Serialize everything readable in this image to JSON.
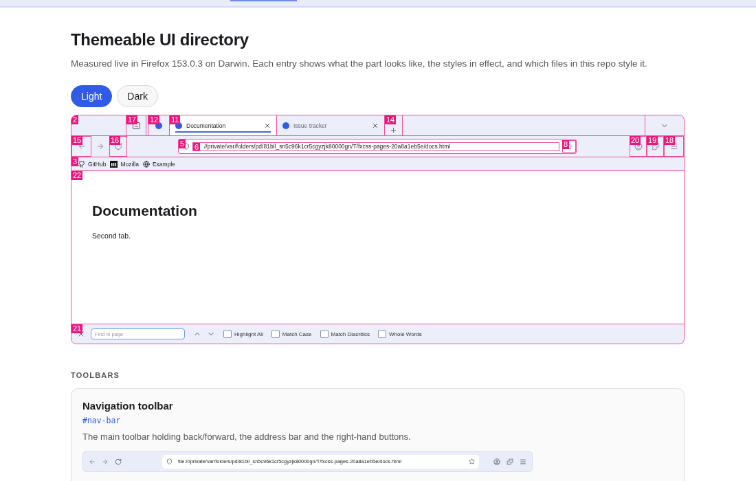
{
  "page": {
    "title": "Themeable UI directory",
    "subtitle": "Measured live in Firefox 153.0.3 on Darwin. Each entry shows what the part looks like, the styles in effect, and which files in this repo style it.",
    "themes": [
      {
        "label": "Light",
        "selected": true
      },
      {
        "label": "Dark",
        "selected": false
      }
    ]
  },
  "browser": {
    "tab_strip": {
      "badge": "2",
      "items": [
        {
          "kind": "button",
          "badge": "17"
        },
        {
          "kind": "pinned-tab",
          "badge": "12"
        },
        {
          "kind": "tab",
          "badge": "11",
          "title": "Documentation",
          "selected": true
        },
        {
          "kind": "tab",
          "title": "Issue tracker",
          "selected": false
        },
        {
          "kind": "new-tab",
          "badge": "14"
        }
      ]
    },
    "nav_bar": {
      "buttons_left": [
        {
          "kind": "back",
          "badge": "15"
        },
        {
          "kind": "forward"
        },
        {
          "kind": "reload",
          "badge": "16"
        }
      ],
      "urlbar": {
        "badge": "5",
        "url_badge": "6",
        "url": "//private/var/folders/pd/81bll_sn5c96k1cr5cgyzjk80000gn/T/fxcss-pages-20a8a1eb5e/docs.html",
        "star_badge": "8"
      },
      "buttons_right": [
        {
          "kind": "account",
          "badge": "20"
        },
        {
          "kind": "extensions",
          "badge": "19"
        },
        {
          "kind": "menu",
          "badge": "18"
        }
      ]
    },
    "bookmarks": {
      "badge": "3",
      "items": [
        {
          "kind": "github",
          "label": "GitHub"
        },
        {
          "kind": "mozilla",
          "label": "Mozilla"
        },
        {
          "kind": "globe",
          "label": "Example"
        }
      ]
    },
    "content": {
      "badge": "22",
      "heading": "Documentation",
      "text": "Second tab."
    },
    "find_bar": {
      "badge": "21",
      "placeholder": "Find in page",
      "options": [
        {
          "label": "Highlight All",
          "checked": false
        },
        {
          "label": "Match Case",
          "checked": false
        },
        {
          "label": "Match Diacritics",
          "checked": false
        },
        {
          "label": "Whole Words",
          "checked": false
        }
      ]
    }
  },
  "section": {
    "label": "TOOLBARS",
    "card": {
      "title": "Navigation toolbar",
      "selector": "#nav-bar",
      "description": "The main toolbar holding back/forward, the address bar and the right-hand buttons.",
      "preview_url": "file:///private/var/folders/pd/81bll_sn5c96k1cr5cgyzjk80000gn/T/fxcss-pages-20a8a1eb5e/docs.html"
    }
  }
}
